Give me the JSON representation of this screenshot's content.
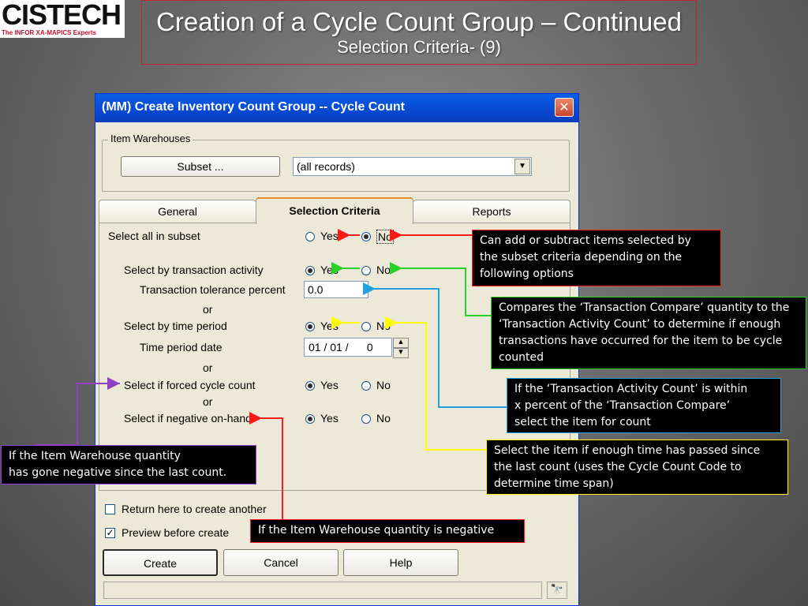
{
  "logo": {
    "word": "CISTECH",
    "tagline": "The INFOR XA-MAPICS Experts"
  },
  "slide": {
    "title": "Creation of a Cycle Count Group – Continued",
    "subtitle": "Selection Criteria- (9)"
  },
  "window": {
    "title": "(MM) Create Inventory Count Group -- Cycle Count",
    "close_glyph": "✕",
    "item_warehouses": {
      "legend": "Item Warehouses",
      "subset_label": "Subset ...",
      "select_value": "(all records)"
    },
    "tabs": [
      {
        "label": "General"
      },
      {
        "label": "Selection Criteria"
      },
      {
        "label": "Reports"
      }
    ],
    "criteria": {
      "select_all": {
        "label": "Select all in subset",
        "yes": "Yes",
        "no": "No",
        "selected": "No"
      },
      "transaction": {
        "label": "Select by transaction activity",
        "yes": "Yes",
        "no": "No",
        "selected": "Yes"
      },
      "tolerance": {
        "label": "Transaction tolerance percent",
        "value": "0.0"
      },
      "or1": "or",
      "time_period": {
        "label": "Select by time period",
        "yes": "Yes",
        "no": "No",
        "selected": "Yes"
      },
      "time_date": {
        "label": "Time period date",
        "value": "01 / 01 /      0"
      },
      "or2": "or",
      "forced": {
        "label": "Select if forced cycle count",
        "yes": "Yes",
        "no": "No",
        "selected": "Yes"
      },
      "or3": "or",
      "negative": {
        "label": "Select if negative on-hand",
        "yes": "Yes",
        "no": "No",
        "selected": "Yes"
      }
    },
    "options": {
      "return_label": "Return here to create another",
      "return_checked": false,
      "preview_label": "Preview before create",
      "preview_checked": true
    },
    "buttons": {
      "create": "Create",
      "cancel": "Cancel",
      "help": "Help"
    },
    "status_icon": "🔭"
  },
  "callouts": {
    "subset": "Can add or subtract items selected by\n the subset criteria depending on the\nfollowing options",
    "compare": "Compares the ‘Transaction Compare’ quantity to the ‘Transaction Activity Count’ to determine if enough transactions have occurred for the item to be cycle counted",
    "within": "If the ‘Transaction Activity Count’ is within\nx percent of the ‘Transaction Compare’\nselect the item for count",
    "time": "Select the item if enough time has passed since the last count (uses the Cycle Count Code to determine time span)",
    "gone_negative": "If the Item Warehouse quantity\n has gone negative since the last count.",
    "is_negative": "If the Item Warehouse quantity is negative"
  },
  "colors": {
    "red": "#ff1a1a",
    "green": "#2ad02a",
    "blue": "#22a0e0",
    "yellow": "#ffff00",
    "purple": "#9040c0"
  }
}
